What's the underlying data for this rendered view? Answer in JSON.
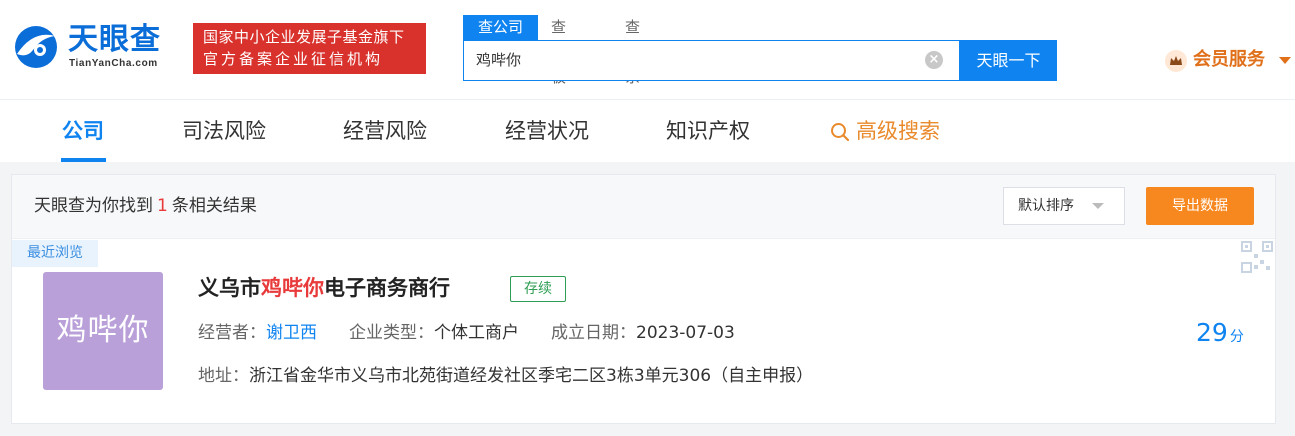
{
  "brand": {
    "name": "天眼查",
    "domain": "TianYanCha.com",
    "badge_line1": "国家中小企业发展子基金旗下",
    "badge_line2": "官方备案企业征信机构"
  },
  "search": {
    "tabs": [
      "查公司",
      "查老板",
      "查关系"
    ],
    "active_tab": "查公司",
    "value": "鸡哔你",
    "button_label": "天眼一下"
  },
  "member": {
    "label": "会员服务"
  },
  "nav": {
    "items": [
      "公司",
      "司法风险",
      "经营风险",
      "经营状况",
      "知识产权"
    ],
    "advanced": "高级搜索"
  },
  "results": {
    "summary_prefix": "天眼查为你找到",
    "count": "1",
    "summary_suffix": "条相关结果",
    "sort_label": "默认排序",
    "export_label": "导出数据",
    "recent_tag": "最近浏览"
  },
  "company": {
    "logo_text": "鸡哔你",
    "name_prefix": "义乌市",
    "name_highlight": "鸡哔你",
    "name_suffix": "电子商务商行",
    "status": "存续",
    "operator_label": "经营者：",
    "operator": "谢卫西",
    "type_label": "企业类型：",
    "type": "个体工商户",
    "date_label": "成立日期：",
    "date": "2023-07-03",
    "address_label": "地址：",
    "address": "浙江省金华市义乌市北苑街道经发社区季宅二区3栋3单元306（自主申报）",
    "score": "29",
    "score_unit": "分"
  },
  "colors": {
    "primary": "#0f84f0",
    "highlight": "#e83a3a",
    "export": "#f7881f",
    "status_green": "#2f9e54",
    "logo_bg": "#b9a0d9",
    "badge_red": "#d9322c"
  }
}
